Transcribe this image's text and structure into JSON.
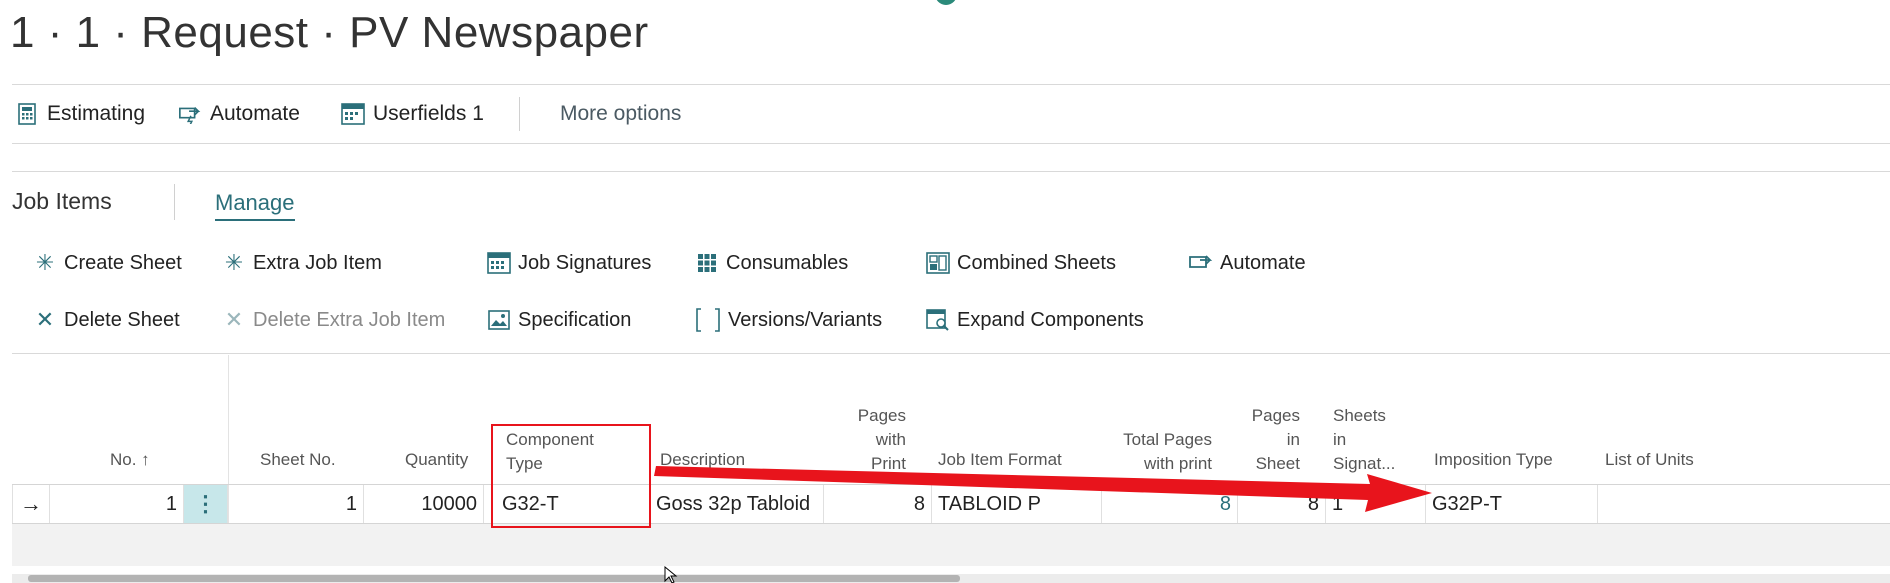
{
  "page": {
    "title": "1 · 1 · Request · PV Newspaper"
  },
  "toolbar": {
    "estimating": "Estimating",
    "automate": "Automate",
    "userfields": "Userfields 1",
    "more_options": "More options"
  },
  "job_items": {
    "title": "Job Items",
    "manage": "Manage",
    "actions": {
      "create_sheet": "Create Sheet",
      "extra_job_item": "Extra Job Item",
      "job_signatures": "Job Signatures",
      "consumables": "Consumables",
      "combined_sheets": "Combined Sheets",
      "automate": "Automate",
      "delete_sheet": "Delete Sheet",
      "delete_extra_job_item": "Delete Extra Job Item",
      "specification": "Specification",
      "versions_variants": "Versions/Variants",
      "expand_components": "Expand Components"
    }
  },
  "table": {
    "headers": {
      "no": "No. ↑",
      "sheet_no": "Sheet No.",
      "quantity": "Quantity",
      "component_type_1": "Component",
      "component_type_2": "Type",
      "description": "Description",
      "pages_with_print_1": "Pages",
      "pages_with_print_2": "with",
      "pages_with_print_3": "Print",
      "job_item_format": "Job Item Format",
      "total_pages_1": "Total Pages",
      "total_pages_2": "with print",
      "pages_in_sheet_1": "Pages",
      "pages_in_sheet_2": "in",
      "pages_in_sheet_3": "Sheet",
      "sheets_1": "Sheets",
      "sheets_2": "in",
      "sheets_3": "Signat...",
      "imposition_type": "Imposition Type",
      "list_of_units": "List of Units"
    },
    "row": {
      "no": "1",
      "sheet_no": "1",
      "quantity": "10000",
      "component_type": "G32-T",
      "description": "Goss 32p Tabloid",
      "pages_with_print": "8",
      "job_item_format": "TABLOID P",
      "total_pages": "8",
      "pages_in_sheet": "8",
      "sheets_in_signature": "1",
      "imposition_type": "G32P-T",
      "list_of_units": ""
    }
  },
  "colors": {
    "accent": "#2b6f7a",
    "annotation": "#e8141c",
    "row_selected": "#c7e7ea"
  }
}
